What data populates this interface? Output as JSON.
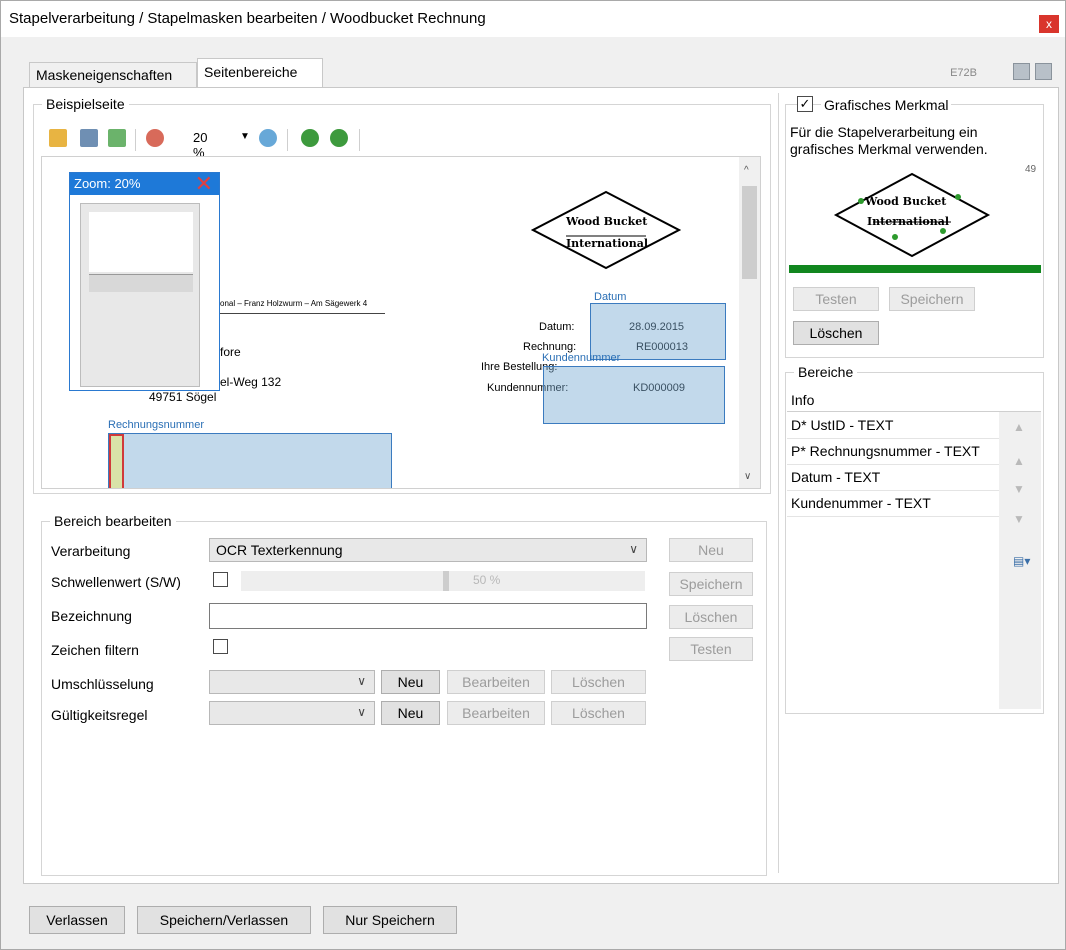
{
  "window": {
    "title": "Stapelverarbeitung / Stapelmasken bearbeiten / Woodbucket Rechnung",
    "close_label": "x"
  },
  "tabs": [
    {
      "label": "Maskeneigenschaften"
    },
    {
      "label": "Seitenbereiche"
    }
  ],
  "header_right": {
    "code": "E72B"
  },
  "beispielseite": {
    "legend": "Beispielseite",
    "zoom_value": "20 %",
    "zoom_popup": {
      "title": "Zoom: 20%"
    },
    "document": {
      "logo_line1": "Wood Bucket",
      "logo_line2": "International",
      "address_line": "onal – Franz Holzwurm – Am Sägewerk 4",
      "recipient_1": "fore",
      "recipient_2": "el-Weg 132",
      "recipient_3": "49751 Sögel",
      "datum_label": "Datum:",
      "datum_value": "28.09.2015",
      "rechnung_label": "Rechnung:",
      "rechnung_value": "RE000013",
      "bestellung_label": "Ihre Bestellung:",
      "kunde_label": "Kundennummer:",
      "kunde_value": "KD000009"
    },
    "regions": {
      "datum": "Datum",
      "kundennummer": "Kundennummer",
      "rechnungsnummer": "Rechnungsnummer"
    }
  },
  "bereich_bearbeiten": {
    "legend": "Bereich bearbeiten",
    "verarbeitung_label": "Verarbeitung",
    "verarbeitung_value": "OCR Texterkennung",
    "schwellenwert_label": "Schwellenwert (S/W)",
    "schwellenwert_pct": "50 %",
    "schwellenwert_level": 0.5,
    "bezeichnung_label": "Bezeichnung",
    "bezeichnung_value": "",
    "zeichen_filtern_label": "Zeichen filtern",
    "umschluesselung_label": "Umschlüsselung",
    "gueltigkeitsregel_label": "Gültigkeitsregel",
    "buttons": {
      "neu": "Neu",
      "speichern": "Speichern",
      "loeschen": "Löschen",
      "testen": "Testen",
      "bearbeiten": "Bearbeiten"
    }
  },
  "grafisches_merkmal": {
    "legend": "Grafisches Merkmal",
    "checked": true,
    "description": "Für die Stapelverarbeitung ein grafisches Merkmal verwenden.",
    "count": "49",
    "logo_line1": "Wood Bucket",
    "logo_line2": "International",
    "buttons": {
      "testen": "Testen",
      "speichern": "Speichern",
      "loeschen": "Löschen"
    }
  },
  "bereiche": {
    "legend": "Bereiche",
    "column": "Info",
    "rows": [
      {
        "label": "D*  UstID - TEXT"
      },
      {
        "label": "P*  Rechnungsnummer - TEXT"
      },
      {
        "label": "Datum - TEXT"
      },
      {
        "label": "Kundenummer - TEXT"
      }
    ]
  },
  "footer": {
    "verlassen": "Verlassen",
    "speichern_verlassen": "Speichern/Verlassen",
    "nur_speichern": "Nur Speichern"
  }
}
